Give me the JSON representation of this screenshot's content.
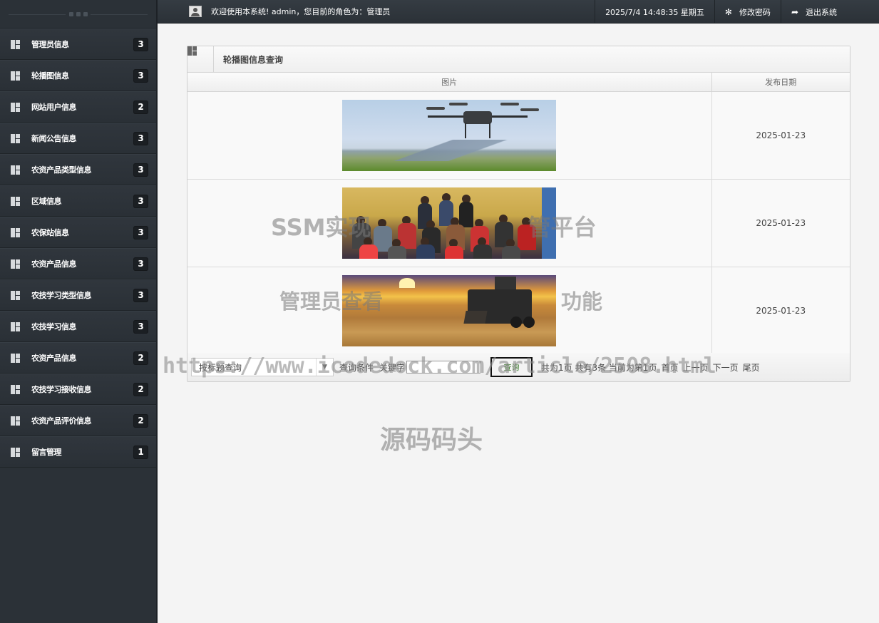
{
  "sidebar": {
    "items": [
      {
        "label": "管理员信息",
        "count": "3"
      },
      {
        "label": "轮播图信息",
        "count": "3"
      },
      {
        "label": "网站用户信息",
        "count": "2"
      },
      {
        "label": "新闻公告信息",
        "count": "3"
      },
      {
        "label": "农资产品类型信息",
        "count": "3"
      },
      {
        "label": "区域信息",
        "count": "3"
      },
      {
        "label": "农保站信息",
        "count": "3"
      },
      {
        "label": "农资产品信息",
        "count": "3"
      },
      {
        "label": "农技学习类型信息",
        "count": "3"
      },
      {
        "label": "农技学习信息",
        "count": "3"
      },
      {
        "label": "农资产品信息",
        "count": "2"
      },
      {
        "label": "农技学习接收信息",
        "count": "2"
      },
      {
        "label": "农资产品评价信息",
        "count": "2"
      },
      {
        "label": "留言管理",
        "count": "1"
      }
    ]
  },
  "topbar": {
    "welcome": "欢迎使用本系统! admin，您目前的角色为：管理员",
    "datetime": "2025/7/4 14:48:35 星期五",
    "change_password": "修改密码",
    "logout": "退出系统"
  },
  "panel": {
    "title": "轮播图信息查询",
    "columns": {
      "image": "图片",
      "date": "发布日期"
    },
    "rows": [
      {
        "date": "2025-01-23"
      },
      {
        "date": "2025-01-23"
      },
      {
        "date": "2025-01-23"
      }
    ]
  },
  "search": {
    "field_select": "按标题查询",
    "condition_label": "查询条件",
    "keyword_label": "关键字",
    "keyword_value": "",
    "query_button": "查询",
    "page_info": "共为1页 共有3条 当前为第1页",
    "first": "首页",
    "prev": "上一页",
    "next": "下一页",
    "last": "尾页"
  },
  "watermarks": {
    "line1": "SSM实现",
    "line1b": "管平台",
    "line2": "管理员查看",
    "line2b": "功能",
    "line3": "https://www.icodedock.com/article/2508.html",
    "line4": "源码码头"
  }
}
